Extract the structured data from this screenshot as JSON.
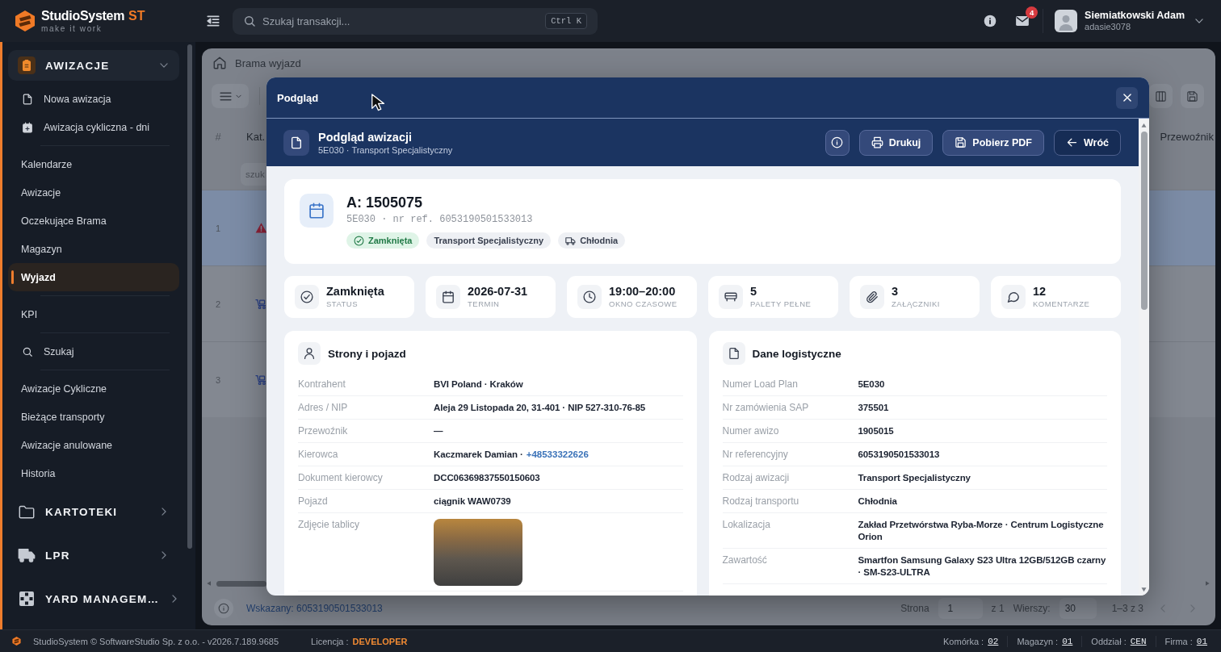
{
  "topbar": {
    "brand": {
      "name": "StudioSystem",
      "suffix": "ST",
      "tagline": "make it work"
    },
    "search": {
      "placeholder": "Szukaj transakcji...",
      "shortcut": "Ctrl K"
    },
    "mail": {
      "badge": "4"
    },
    "user": {
      "name": "Siemiatkowski Adam",
      "username": "adasie3078"
    }
  },
  "sidebar": {
    "groups": [
      {
        "label": "AWIZACJE",
        "expanded": true,
        "sections": [
          {
            "items": [
              {
                "label": "Nowa awizacja",
                "selected": false
              },
              {
                "label": "Awizacja cykliczna - dni",
                "selected": false
              }
            ]
          },
          {
            "items": [
              {
                "label": "Kalendarze",
                "selected": false
              },
              {
                "label": "Awizacje",
                "selected": false
              },
              {
                "label": "Oczekujące Brama",
                "selected": false
              },
              {
                "label": "Magazyn",
                "selected": false
              },
              {
                "label": "Wyjazd",
                "selected": true
              }
            ]
          },
          {
            "items": [
              {
                "label": "KPI",
                "selected": false
              }
            ]
          },
          {
            "items": [
              {
                "label": "Szukaj",
                "selected": false
              }
            ]
          },
          {
            "items": [
              {
                "label": "Awizacje Cykliczne",
                "selected": false
              },
              {
                "label": "Bieżące transporty",
                "selected": false
              },
              {
                "label": "Awizacje anulowane",
                "selected": false
              },
              {
                "label": "Historia",
                "selected": false
              }
            ]
          }
        ]
      },
      {
        "label": "KARTOTEKI",
        "expanded": false
      },
      {
        "label": "LPR",
        "expanded": false
      },
      {
        "label": "YARD MANAGEM…",
        "expanded": false
      }
    ]
  },
  "page": {
    "breadcrumb": "Brama wyjazd",
    "table": {
      "columns": [
        {
          "label": "#"
        },
        {
          "label": "Kat."
        },
        {
          "label": "Przewoźnik"
        }
      ],
      "filter": {
        "placeholder": "szuk"
      },
      "rows": [
        {
          "number": "1",
          "kind": "alert",
          "selected": true
        },
        {
          "number": "2",
          "kind": "standard",
          "selected": false
        },
        {
          "number": "3",
          "kind": "standard",
          "selected": false
        }
      ]
    },
    "footer": {
      "selected_ref": "Wskazany: 6053190501533013",
      "page_label": "Strona",
      "page": "1",
      "page_count": "z 1",
      "rows_label": "Wierszy:",
      "rows_per_page": "30",
      "range": "1–3 z 3"
    }
  },
  "modal": {
    "title": "Podgląd",
    "header": {
      "title": "Podgląd awizacji",
      "subtitle": "5E030 · Transport Specjalistyczny",
      "buttons": [
        {
          "kind": "icon"
        },
        {
          "kind": "action",
          "label": "Drukuj"
        },
        {
          "kind": "action",
          "label": "Pobierz PDF"
        },
        {
          "kind": "back",
          "label": "Wróć"
        }
      ]
    },
    "summary": {
      "title": "A: 1505075",
      "meta": "5E030 · nr ref. 6053190501533013",
      "tags": [
        {
          "kind": "status",
          "label": "Zamknięta"
        },
        {
          "kind": "plain",
          "label": "Transport Specjalistyczny"
        },
        {
          "kind": "vehicle",
          "label": "Chłodnia"
        }
      ]
    },
    "stats": [
      {
        "value": "Zamknięta",
        "label": "STATUS"
      },
      {
        "value": "2026-07-31",
        "label": "TERMIN"
      },
      {
        "value": "19:00–20:00",
        "label": "OKNO CZASOWE"
      },
      {
        "value": "5",
        "label": "PALETY PEŁNE"
      },
      {
        "value": "3",
        "label": "ZAŁĄCZNIKI"
      },
      {
        "value": "12",
        "label": "KOMENTARZE"
      }
    ],
    "sections": [
      {
        "title": "Strony i pojazd",
        "rows": [
          {
            "kind": "text",
            "label": "Kontrahent",
            "value": "BVI Poland · Kraków"
          },
          {
            "kind": "text",
            "label": "Adres / NIP",
            "value": "Aleja 29 Listopada 20, 31-401 · NIP 527-310-76-85"
          },
          {
            "kind": "text",
            "label": "Przewoźnik",
            "value": "—"
          },
          {
            "kind": "text",
            "label": "Kierowca",
            "value": "Kaczmarek Damian ·",
            "link": "+48533322626"
          },
          {
            "kind": "text",
            "label": "Dokument kierowcy",
            "value": "DCC06369837550150603"
          },
          {
            "kind": "text",
            "label": "Pojazd",
            "value": "ciągnik WAW0739"
          },
          {
            "kind": "photo",
            "label": "Zdjęcie tablicy"
          }
        ]
      },
      {
        "title": "Dane logistyczne",
        "rows": [
          {
            "kind": "text",
            "label": "Numer Load Plan",
            "value": "5E030"
          },
          {
            "kind": "text",
            "label": "Nr zamówienia SAP",
            "value": "375501"
          },
          {
            "kind": "text",
            "label": "Numer awizo",
            "value": "1905015"
          },
          {
            "kind": "text",
            "label": "Nr referencyjny",
            "value": "6053190501533013"
          },
          {
            "kind": "text",
            "label": "Rodzaj awizacji",
            "value": "Transport Specjalistyczny"
          },
          {
            "kind": "text",
            "label": "Rodzaj transportu",
            "value": "Chłodnia"
          },
          {
            "kind": "text",
            "label": "Lokalizacja",
            "value": "Zakład Przetwórstwa Ryba-Morze · Centrum Logistyczne Orion"
          },
          {
            "kind": "text",
            "label": "Zawartość",
            "value": "Smartfon Samsung Galaxy S23 Ultra 12GB/512GB czarny · SM-S23-ULTRA"
          }
        ]
      }
    ]
  },
  "status_bar": {
    "copyright": "StudioSystem © SoftwareStudio Sp. z o.o. - v2026.7.189.9685",
    "license_label": "Licencja :",
    "license": "DEVELOPER",
    "context": [
      {
        "label": "Komórka :",
        "value": "02"
      },
      {
        "label": "Magazyn :",
        "value": "01"
      },
      {
        "label": "Oddział :",
        "value": "CEN"
      },
      {
        "label": "Firma :",
        "value": "01"
      }
    ]
  }
}
